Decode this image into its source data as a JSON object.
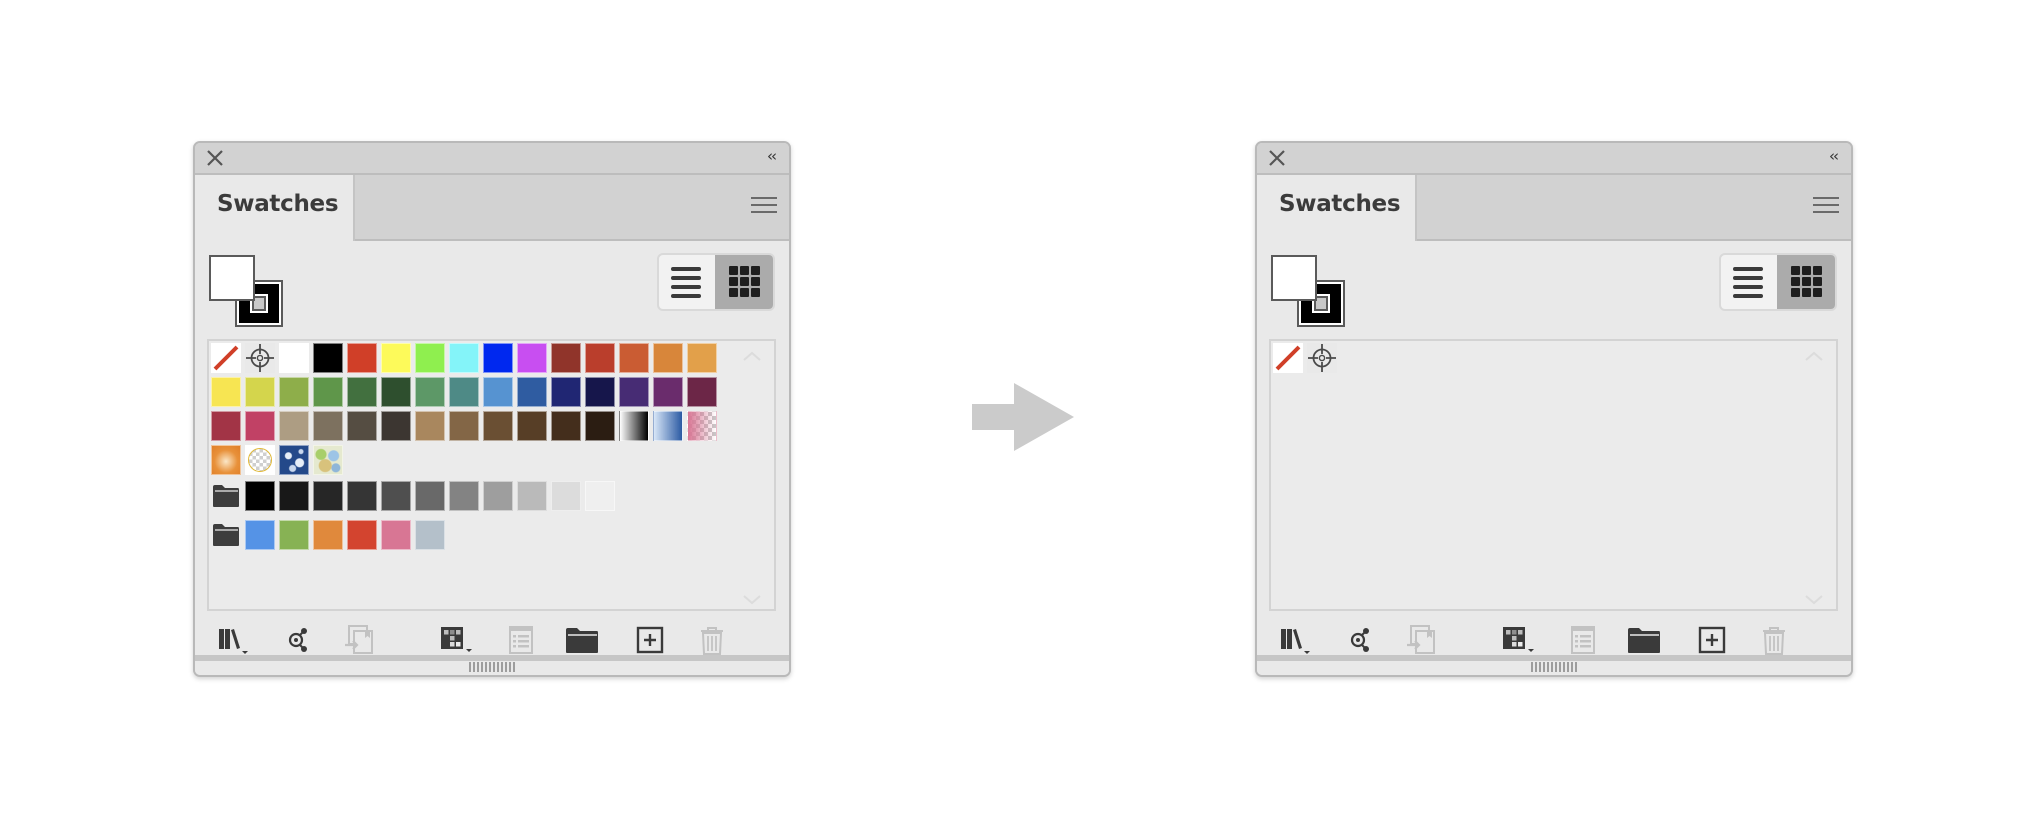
{
  "panels": [
    {
      "id": "before",
      "tab_label": "Swatches",
      "collapse_label": "‹‹",
      "icons": {
        "close": "close-icon",
        "collapse": "double-chevron-left-icon",
        "menu": "hamburger-menu-icon",
        "list_view": "list-view-icon",
        "grid_view": "grid-view-icon"
      },
      "fill_color": "#ffffff",
      "stroke_color": "#000000",
      "active_view": "grid",
      "swatch_rows": [
        [
          "none",
          "registration",
          "#ffffff",
          "#000000",
          "#d03f28",
          "#fdfa5a",
          "#8fef4f",
          "#84f4f9",
          "#0028ef",
          "#c84ef1",
          "#90342a",
          "#ba3e2c",
          "#ca5c33",
          "#d8863a",
          "#e2a04a"
        ],
        [
          "#f7e552",
          "#d4d54c",
          "#8eae4a",
          "#5f964a",
          "#42703f",
          "#2e4f2e",
          "#5d9867",
          "#4e8a86",
          "#5693d1",
          "#2f5ca1",
          "#202673",
          "#16164b",
          "#472c74",
          "#6a2c6c",
          "#6c2647"
        ],
        [
          "#a23446",
          "#c14165",
          "#ad9d83",
          "#7d715f",
          "#554d42",
          "#3c3631",
          "#a9875e",
          "#836646",
          "#6a4f33",
          "#573e26",
          "#442e1c",
          "#2b1d12",
          "gradient:linear-gradient(90deg,#ffffff,#000000)",
          "gradient:linear-gradient(90deg,#d8e6f7,#2b5aa3)",
          "pattern:checker-pink"
        ],
        [
          "gradient:radial-gradient(circle at 50% 55%,#fbe7c7 0%,#e8913a 55%,#e07f28 100%)",
          "pattern:checker-circle",
          "pattern:blue-damask",
          "pattern:camo"
        ]
      ],
      "groups": [
        {
          "icon": "folder-icon",
          "colors": [
            "#000000",
            "#181818",
            "#262626",
            "#353535",
            "#4f4f4f",
            "#696969",
            "#838383",
            "#9e9e9e",
            "#bababa",
            "#dcdcdc",
            "#efefef"
          ]
        },
        {
          "icon": "folder-icon",
          "colors": [
            "#5593e6",
            "#87b254",
            "#e0893c",
            "#d3442f",
            "#d87694",
            "#b4c0ca"
          ]
        }
      ],
      "toolbar": [
        {
          "name": "swatch-libraries-menu-button",
          "icon": "library-books-icon",
          "enabled": true,
          "has_dropdown": true
        },
        {
          "name": "swatch-kind-menu-button",
          "icon": "share-link-icon",
          "enabled": true,
          "has_dropdown": false
        },
        {
          "name": "place-swatches-button",
          "icon": "place-swatch-icon",
          "enabled": false,
          "has_dropdown": false
        },
        {
          "name": "show-swatch-kinds-button",
          "icon": "swatch-grid-icon",
          "enabled": true,
          "has_dropdown": true
        },
        {
          "name": "swatch-options-button",
          "icon": "swatch-options-list-icon",
          "enabled": false,
          "has_dropdown": false
        },
        {
          "name": "new-color-group-button",
          "icon": "folder-icon",
          "enabled": true,
          "has_dropdown": false
        },
        {
          "name": "new-swatch-button",
          "icon": "plus-square-icon",
          "enabled": true,
          "has_dropdown": false
        },
        {
          "name": "delete-swatch-button",
          "icon": "trash-icon",
          "enabled": false,
          "has_dropdown": false
        }
      ]
    },
    {
      "id": "after",
      "tab_label": "Swatches",
      "collapse_label": "‹‹",
      "icons": {
        "close": "close-icon",
        "collapse": "double-chevron-left-icon",
        "menu": "hamburger-menu-icon",
        "list_view": "list-view-icon",
        "grid_view": "grid-view-icon"
      },
      "fill_color": "#ffffff",
      "stroke_color": "#000000",
      "active_view": "grid",
      "swatch_rows": [
        [
          "none",
          "registration"
        ]
      ],
      "groups": [],
      "toolbar": [
        {
          "name": "swatch-libraries-menu-button",
          "icon": "library-books-icon",
          "enabled": true,
          "has_dropdown": true
        },
        {
          "name": "swatch-kind-menu-button",
          "icon": "share-link-icon",
          "enabled": true,
          "has_dropdown": false
        },
        {
          "name": "place-swatches-button",
          "icon": "place-swatch-icon",
          "enabled": false,
          "has_dropdown": false
        },
        {
          "name": "show-swatch-kinds-button",
          "icon": "swatch-grid-icon",
          "enabled": true,
          "has_dropdown": true
        },
        {
          "name": "swatch-options-button",
          "icon": "swatch-options-list-icon",
          "enabled": false,
          "has_dropdown": false
        },
        {
          "name": "new-color-group-button",
          "icon": "folder-icon",
          "enabled": true,
          "has_dropdown": false
        },
        {
          "name": "new-swatch-button",
          "icon": "plus-square-icon",
          "enabled": true,
          "has_dropdown": false
        },
        {
          "name": "delete-swatch-button",
          "icon": "trash-icon",
          "enabled": false,
          "has_dropdown": false
        }
      ]
    }
  ],
  "transition_arrow": {
    "icon": "right-arrow-icon",
    "color": "#cbcbcb"
  }
}
